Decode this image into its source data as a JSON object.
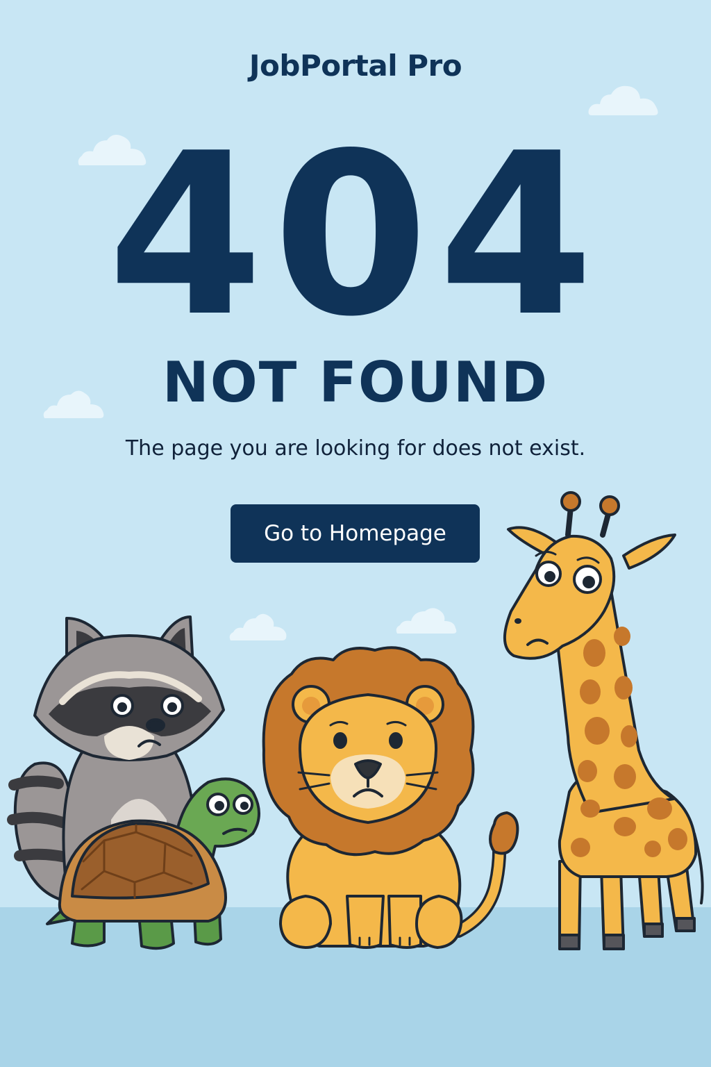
{
  "header": {
    "brand": "JobPortal Pro"
  },
  "error": {
    "code": "404",
    "title": "NOT FOUND",
    "message": "The page you are looking for does not exist."
  },
  "actions": {
    "home_button_label": "Go to Homepage"
  },
  "illustration": {
    "animals": [
      "raccoon",
      "turtle",
      "lion",
      "giraffe"
    ]
  },
  "colors": {
    "background": "#c8e6f4",
    "floor": "#a9d4e8",
    "primary": "#0f3358",
    "button_text": "#ffffff"
  }
}
